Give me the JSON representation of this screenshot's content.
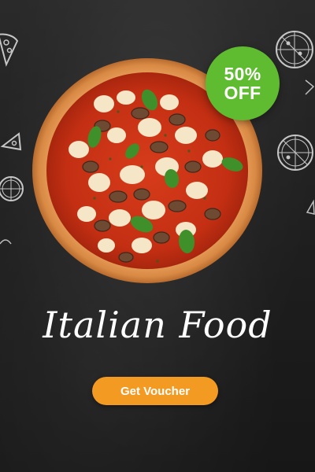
{
  "banner": {
    "discount": {
      "percent": "50%",
      "off": "OFF"
    },
    "title": "Italian Food",
    "cta_label": "Get Voucher"
  },
  "colors": {
    "background": "#1f1f1f",
    "badge": "#5fbb2f",
    "button": "#f39a23",
    "text": "#ffffff"
  },
  "icons": [
    "pizza-slice-icon",
    "pizza-top-view-icon",
    "pizza-slice-icon",
    "pizza-top-view-icon"
  ]
}
